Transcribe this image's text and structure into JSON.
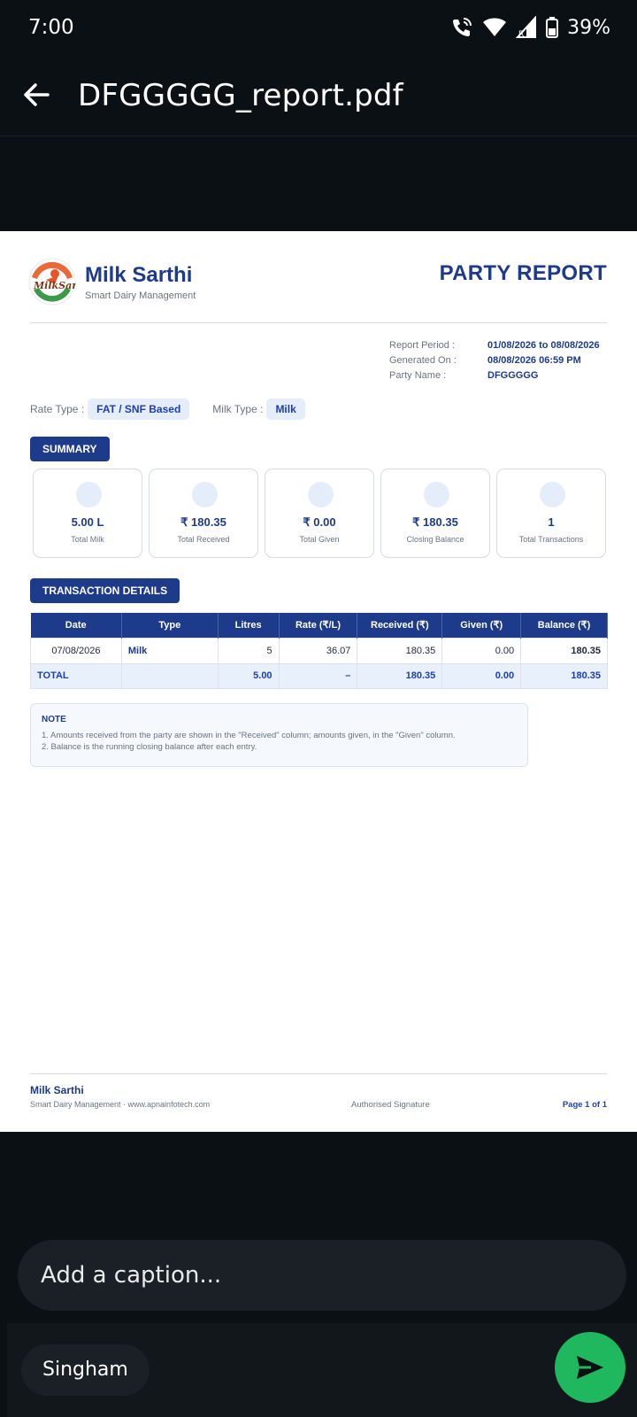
{
  "status": {
    "time": "7:00",
    "battery": "39%"
  },
  "header": {
    "title": "DFGGGGG_report.pdf"
  },
  "report": {
    "brand_name": "Milk Sarthi",
    "brand_tagline": "Smart Dairy Management",
    "title": "PARTY REPORT",
    "meta": [
      {
        "label": "Report Period :",
        "value": "01/08/2026 to 08/08/2026"
      },
      {
        "label": "Generated On :",
        "value": "08/08/2026 06:59 PM"
      },
      {
        "label": "Party Name :",
        "value": "DFGGGGG"
      }
    ],
    "rate_type_label": "Rate Type :",
    "rate_type_value": "FAT / SNF Based",
    "milk_type_label": "Milk Type :",
    "milk_type_value": "Milk",
    "summary_heading": "SUMMARY",
    "summary": [
      {
        "value": "5.00 L",
        "label": "Total Milk"
      },
      {
        "value": "₹ 180.35",
        "label": "Total Received"
      },
      {
        "value": "₹ 0.00",
        "label": "Total Given"
      },
      {
        "value": "₹ 180.35",
        "label": "Closing Balance"
      },
      {
        "value": "1",
        "label": "Total Transactions"
      }
    ],
    "transactions_heading": "TRANSACTION DETAILS",
    "table": {
      "headers": [
        "Date",
        "Type",
        "Litres",
        "Rate (₹/L)",
        "Received (₹)",
        "Given (₹)",
        "Balance (₹)"
      ],
      "rows": [
        [
          "07/08/2026",
          "Milk",
          "5",
          "36.07",
          "180.35",
          "0.00",
          "180.35"
        ]
      ],
      "total": [
        "TOTAL",
        "",
        "5.00",
        "–",
        "180.35",
        "0.00",
        "180.35"
      ]
    },
    "note": {
      "title": "NOTE",
      "lines": [
        "1. Amounts received from the party are shown in the \"Received\" column; amounts given, in the \"Given\" column.",
        "2. Balance is the running closing balance after each entry."
      ]
    },
    "footer": {
      "name": "Milk Sarthi",
      "sub": "Smart Dairy Management · www.apnainfotech.com",
      "signature": "Authorised Signature",
      "page": "Page 1 of 1"
    }
  },
  "caption": {
    "placeholder": "Add a caption..."
  },
  "recipient": "Singham",
  "colors": {
    "brand": "#1e3a8a",
    "send": "#1fb85f",
    "background": "#0b1014"
  }
}
